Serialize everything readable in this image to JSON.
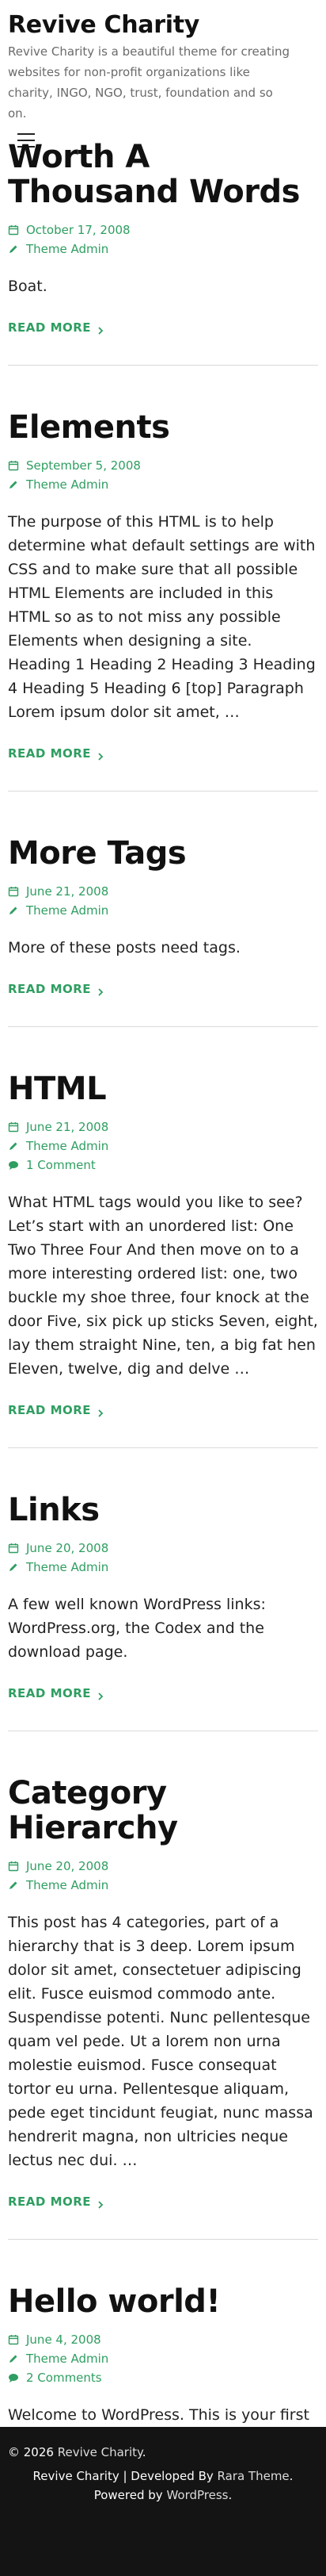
{
  "site": {
    "title": "Revive Charity",
    "description": "Revive Charity is a beautiful theme for creating websites for non-profit organizations like charity, INGO, NGO, trust, foundation and so on."
  },
  "read_more_label": "READ MORE",
  "posts": [
    {
      "title": "Worth A Thousand Words",
      "date": "October 17, 2008",
      "author": "Theme Admin",
      "comments": "",
      "excerpt": "Boat."
    },
    {
      "title": "Elements",
      "date": "September 5, 2008",
      "author": "Theme Admin",
      "comments": "",
      "excerpt": "The purpose of this HTML is to help determine what default settings are with CSS and to make sure that all possible HTML Elements are included in this HTML so as to not miss any possible Elements when designing a site. Heading 1 Heading 2 Heading 3 Heading 4 Heading 5 Heading 6 [top] Paragraph Lorem ipsum dolor sit amet, …"
    },
    {
      "title": "More Tags",
      "date": "June 21, 2008",
      "author": "Theme Admin",
      "comments": "",
      "excerpt": "More of these posts need tags."
    },
    {
      "title": "HTML",
      "date": "June 21, 2008",
      "author": "Theme Admin",
      "comments": "1 Comment",
      "excerpt": "What HTML tags would you like to see? Let’s start with an unordered list: One Two Three Four And then move on to a more interesting ordered list: one, two buckle my shoe three, four knock at the door Five, six pick up sticks Seven, eight, lay them straight Nine, ten, a big fat hen Eleven, twelve, dig and delve …"
    },
    {
      "title": "Links",
      "date": "June 20, 2008",
      "author": "Theme Admin",
      "comments": "",
      "excerpt": "A few well known WordPress links: WordPress.org, the Codex and the download page."
    },
    {
      "title": "Category Hierarchy",
      "date": "June 20, 2008",
      "author": "Theme Admin",
      "comments": "",
      "excerpt": "This post has 4 categories, part of a hierarchy that is 3 deep. Lorem ipsum dolor sit amet, consectetuer adipiscing elit. Fusce euismod commodo ante. Suspendisse potenti. Nunc pellentesque quam vel pede. Ut a lorem non urna molestie euismod. Fusce consequat tortor eu urna. Pellentesque aliquam, pede eget tincidunt feugiat, nunc massa hendrerit magna, non ultricies neque lectus nec dui. …"
    },
    {
      "title": "Hello world!",
      "date": "June 4, 2008",
      "author": "Theme Admin",
      "comments": "2 Comments",
      "excerpt": "Welcome to WordPress. This is your first post. Edit or delete it, then start blogging!"
    }
  ],
  "footer": {
    "copyright_prefix": "© 2026 ",
    "copyright_link": "Revive Charity",
    "copyright_suffix": ".",
    "credits_a": "Revive Charity | Developed By ",
    "credits_link1": "Rara Theme",
    "credits_b": ". Powered by ",
    "credits_link2": "WordPress",
    "credits_c": "."
  },
  "colors": {
    "accent": "#2f9e61",
    "footer_bg": "#141414"
  },
  "icons": {
    "date": "calendar-icon",
    "author": "pencil-icon",
    "comments": "comment-icon",
    "menu": "hamburger-menu-icon",
    "read_more": "chevron-right-icon"
  }
}
